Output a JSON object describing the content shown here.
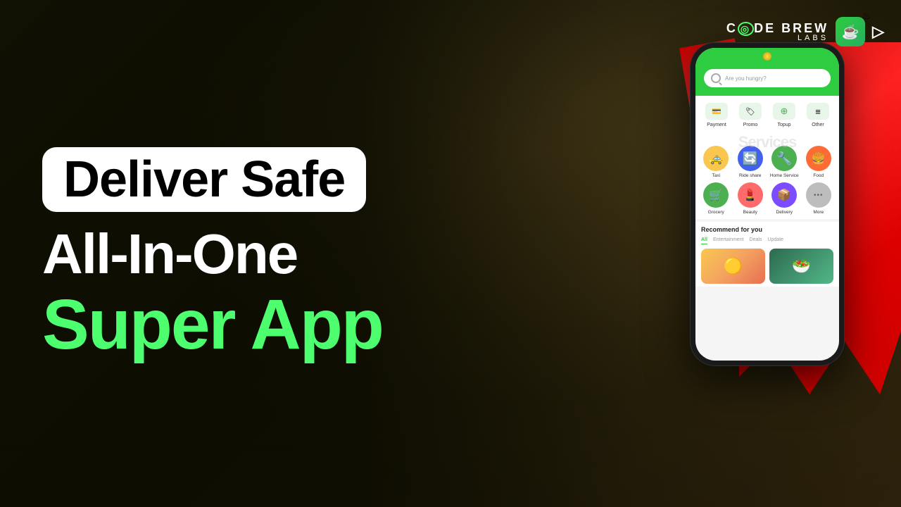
{
  "background": {
    "gradient_description": "dark olive/brown toned blurred outdoor scene with person"
  },
  "logo": {
    "brand_name": "C◎DE BREW",
    "sub_name": "LABS",
    "icon_emoji": "🍵",
    "steam_symbol": "♨",
    "arrow": "▷"
  },
  "hero": {
    "line1": "Deliver Safe",
    "line2": "All-In-One",
    "line3": "Super App"
  },
  "phone": {
    "search_placeholder": "Are you hungry?",
    "bell_indicator": "🔔",
    "quick_actions": [
      {
        "label": "Payment",
        "icon": "💳",
        "bg": "#e8f5e9"
      },
      {
        "label": "Promo",
        "icon": "🏷️",
        "bg": "#e8f5e9"
      },
      {
        "label": "Topup",
        "icon": "➕",
        "bg": "#e8f5e9"
      },
      {
        "label": "Other",
        "icon": "☰",
        "bg": "#e8f5e9"
      }
    ],
    "services_watermark": "Services",
    "services": [
      {
        "label": "Taxi",
        "icon": "🚕",
        "color_class": "icon-taxi"
      },
      {
        "label": "Ride share",
        "icon": "🔵",
        "color_class": "icon-ride"
      },
      {
        "label": "Home Service",
        "icon": "🔧",
        "color_class": "icon-home"
      },
      {
        "label": "Food",
        "icon": "🍔",
        "color_class": "icon-food"
      },
      {
        "label": "Grocery",
        "icon": "🛒",
        "color_class": "icon-grocery"
      },
      {
        "label": "Beauty",
        "icon": "💄",
        "color_class": "icon-beauty"
      },
      {
        "label": "Delivery",
        "icon": "📦",
        "color_class": "icon-delivery"
      },
      {
        "label": "More",
        "icon": "•••",
        "color_class": "icon-more"
      }
    ],
    "recommend_title": "Recommend for you",
    "recommend_tabs": [
      {
        "label": "All",
        "active": true
      },
      {
        "label": "Entertainment",
        "active": false
      },
      {
        "label": "Deals",
        "active": false
      },
      {
        "label": "Update",
        "active": false
      }
    ]
  }
}
